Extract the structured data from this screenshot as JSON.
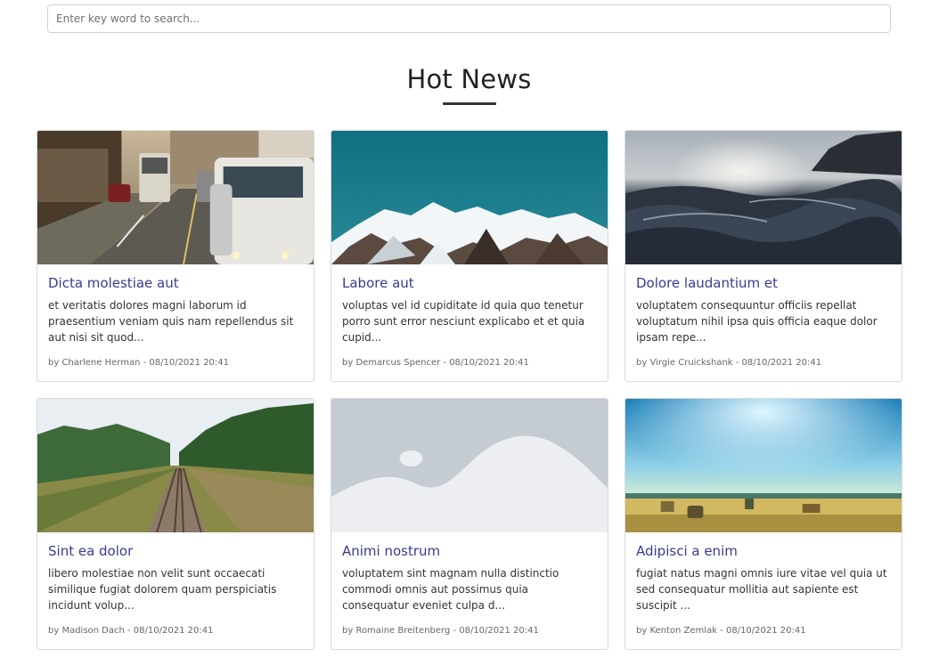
{
  "search": {
    "placeholder": "Enter key word to search..."
  },
  "section": {
    "title": "Hot News"
  },
  "articles": [
    {
      "title": "Dicta molestiae aut",
      "excerpt": "et veritatis dolores magni laborum id praesentium veniam quis nam repellendus sit aut nisi sit quod...",
      "meta": "by Charlene Herman - 08/10/2021 20:41",
      "image": "city-street-traffic"
    },
    {
      "title": "Labore aut",
      "excerpt": "voluptas vel id cupiditate id quia quo tenetur porro sunt error nesciunt explicabo et et quia cupid...",
      "meta": "by Demarcus Spencer - 08/10/2021 20:41",
      "image": "snowy-mountains"
    },
    {
      "title": "Dolore laudantium et",
      "excerpt": "voluptatem consequuntur officiis repellat voluptatum nihil ipsa quis officia eaque dolor ipsam repe...",
      "meta": "by Virgie Cruickshank - 08/10/2021 20:41",
      "image": "ocean-waves"
    },
    {
      "title": "Sint ea dolor",
      "excerpt": "libero molestiae non velit sunt occaecati similique fugiat dolorem quam perspiciatis incidunt volup...",
      "meta": "by Madison Dach - 08/10/2021 20:41",
      "image": "railway-forest"
    },
    {
      "title": "Animi nostrum",
      "excerpt": "voluptatem sint magnam nulla distinctio commodi omnis aut possimus quia consequatur eveniet culpa d...",
      "meta": "by Romaine Breitenberg - 08/10/2021 20:41",
      "image": "image-placeholder"
    },
    {
      "title": "Adipisci a enim",
      "excerpt": "fugiat natus magni omnis iure vitae vel quia ut sed consequatur mollitia aut sapiente est suscipit ...",
      "meta": "by Kenton Zemlak - 08/10/2021 20:41",
      "image": "field-landscape"
    }
  ]
}
